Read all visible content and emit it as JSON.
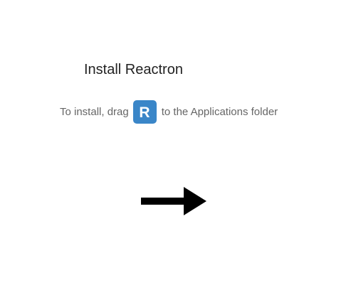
{
  "window": {
    "title": "Install Reactron"
  },
  "instruction": {
    "prefix": "To install, drag",
    "suffix": "to the Applications folder"
  },
  "app_icon": {
    "letter": "R",
    "color": "#3a86c8"
  },
  "arrow": {
    "icon": "arrow-right-icon",
    "color": "#000000"
  }
}
